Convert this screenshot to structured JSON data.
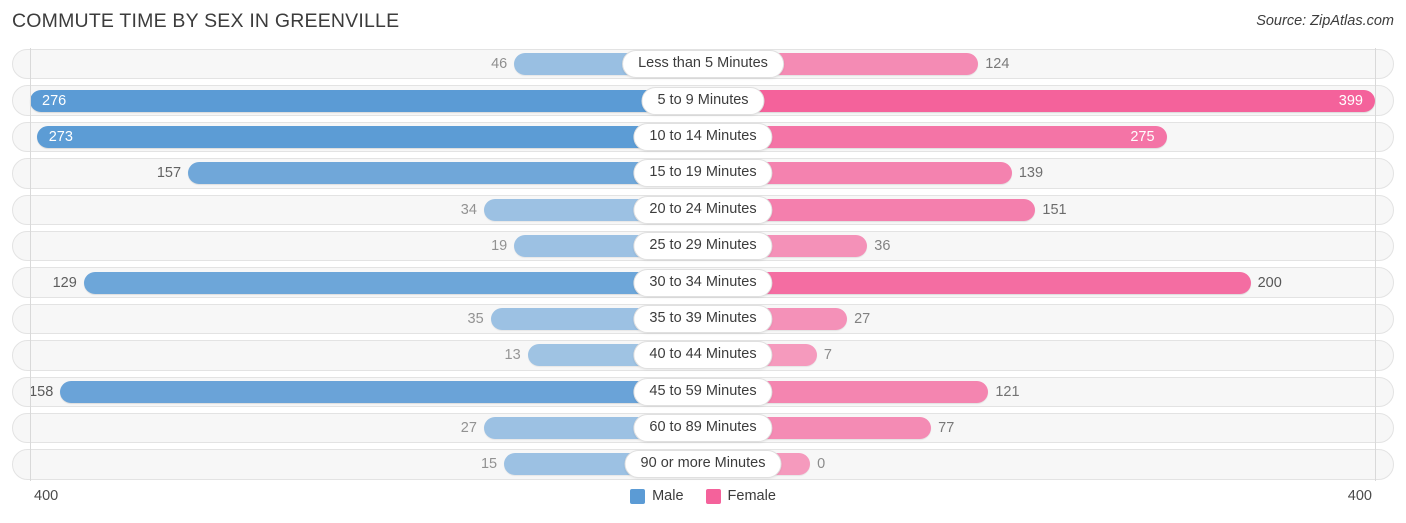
{
  "header": {
    "title": "COMMUTE TIME BY SEX IN GREENVILLE",
    "source": "Source: ZipAtlas.com"
  },
  "axis": {
    "left_max": "400",
    "right_max": "400"
  },
  "legend": {
    "male_label": "Male",
    "female_label": "Female",
    "male_color": "#5b9bd5",
    "female_color": "#f4629b"
  },
  "chart_data": {
    "type": "bar",
    "title": "COMMUTE TIME BY SEX IN GREENVILLE",
    "subtitle": "Source: ZipAtlas.com",
    "orientation": "horizontal-diverging",
    "xlabel": "",
    "ylabel": "",
    "xlim": [
      400,
      400
    ],
    "grid": false,
    "legend_position": "bottom-center",
    "categories": [
      "Less than 5 Minutes",
      "5 to 9 Minutes",
      "10 to 14 Minutes",
      "15 to 19 Minutes",
      "20 to 24 Minutes",
      "25 to 29 Minutes",
      "30 to 34 Minutes",
      "35 to 39 Minutes",
      "40 to 44 Minutes",
      "45 to 59 Minutes",
      "60 to 89 Minutes",
      "90 or more Minutes"
    ],
    "series": [
      {
        "name": "Male",
        "color": "#5b9bd5",
        "values": [
          46,
          276,
          273,
          157,
          34,
          19,
          129,
          35,
          13,
          158,
          27,
          15
        ]
      },
      {
        "name": "Female",
        "color": "#f4629b",
        "values": [
          124,
          399,
          275,
          139,
          151,
          36,
          200,
          27,
          7,
          121,
          77,
          0
        ]
      }
    ]
  },
  "rows": [
    {
      "label": "Less than 5 Minutes",
      "male": "46",
      "female": "124",
      "male_pct": 28.0,
      "female_pct": 41.0,
      "male_inside": false,
      "female_inside": false,
      "male_alpha": 0.6,
      "female_alpha": 0.72
    },
    {
      "label": "5 to 9 Minutes",
      "male": "276",
      "female": "399",
      "male_pct": 100.0,
      "female_pct": 100.0,
      "male_inside": true,
      "female_inside": true,
      "male_alpha": 1.0,
      "female_alpha": 1.0
    },
    {
      "label": "10 to 14 Minutes",
      "male": "273",
      "female": "275",
      "male_pct": 99.0,
      "female_pct": 69.0,
      "male_inside": true,
      "female_inside": true,
      "male_alpha": 0.99,
      "female_alpha": 0.88
    },
    {
      "label": "15 to 19 Minutes",
      "male": "157",
      "female": "139",
      "male_pct": 76.5,
      "female_pct": 46.0,
      "male_inside": false,
      "female_inside": false,
      "male_alpha": 0.86,
      "female_alpha": 0.78
    },
    {
      "label": "20 to 24 Minutes",
      "male": "34",
      "female": "151",
      "male_pct": 32.5,
      "female_pct": 49.5,
      "male_inside": false,
      "female_inside": false,
      "male_alpha": 0.58,
      "female_alpha": 0.8
    },
    {
      "label": "25 to 29 Minutes",
      "male": "19",
      "female": "36",
      "male_pct": 28.0,
      "female_pct": 24.5,
      "male_inside": false,
      "female_inside": false,
      "male_alpha": 0.58,
      "female_alpha": 0.68
    },
    {
      "label": "30 to 34 Minutes",
      "male": "129",
      "female": "200",
      "male_pct": 92.0,
      "female_pct": 81.5,
      "male_inside": false,
      "female_inside": false,
      "male_alpha": 0.88,
      "female_alpha": 0.92
    },
    {
      "label": "35 to 39 Minutes",
      "male": "35",
      "female": "27",
      "male_pct": 31.5,
      "female_pct": 21.5,
      "male_inside": false,
      "female_inside": false,
      "male_alpha": 0.58,
      "female_alpha": 0.68
    },
    {
      "label": "40 to 44 Minutes",
      "male": "13",
      "female": "7",
      "male_pct": 26.0,
      "female_pct": 17.0,
      "male_inside": false,
      "female_inside": false,
      "male_alpha": 0.56,
      "female_alpha": 0.62
    },
    {
      "label": "45 to 59 Minutes",
      "male": "158",
      "female": "121",
      "male_pct": 95.5,
      "female_pct": 42.5,
      "male_inside": false,
      "female_inside": false,
      "male_alpha": 0.9,
      "female_alpha": 0.76
    },
    {
      "label": "60 to 89 Minutes",
      "male": "27",
      "female": "77",
      "male_pct": 32.5,
      "female_pct": 34.0,
      "male_inside": false,
      "female_inside": false,
      "male_alpha": 0.58,
      "female_alpha": 0.72
    },
    {
      "label": "90 or more Minutes",
      "male": "15",
      "female": "0",
      "male_pct": 29.5,
      "female_pct": 16.0,
      "male_inside": false,
      "female_inside": false,
      "male_alpha": 0.58,
      "female_alpha": 0.62
    }
  ]
}
